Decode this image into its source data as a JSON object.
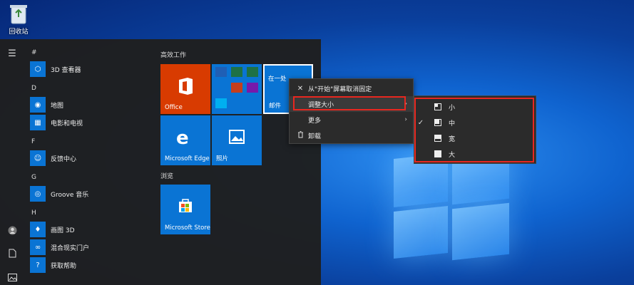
{
  "desktop": {
    "recycle_bin_label": "回收站"
  },
  "start_menu": {
    "letters": [
      "#",
      "D",
      "F",
      "G",
      "H"
    ],
    "apps": [
      {
        "name": "3D 查看器",
        "icon": "cube-icon"
      },
      {
        "name": "地图",
        "icon": "map-pin-icon"
      },
      {
        "name": "电影和电视",
        "icon": "film-icon"
      },
      {
        "name": "反馈中心",
        "icon": "feedback-icon"
      },
      {
        "name": "Groove 音乐",
        "icon": "music-disc-icon"
      },
      {
        "name": "画图 3D",
        "icon": "paint-drop-icon"
      },
      {
        "name": "混合现实门户",
        "icon": "mixed-reality-icon"
      },
      {
        "name": "获取帮助",
        "icon": "help-icon"
      }
    ],
    "groups": {
      "productivity": "高效工作",
      "browse": "浏览"
    },
    "tiles": {
      "office": "Office",
      "mail_text": "在一处查看所有邮件",
      "mail_short": "在一处",
      "mail_label": "邮件",
      "edge": "Microsoft Edge",
      "photos": "照片",
      "store": "Microsoft Store"
    }
  },
  "context_menu": {
    "items": [
      {
        "label": "从\"开始\"屏幕取消固定",
        "icon": "unpin-icon"
      },
      {
        "label": "调整大小",
        "icon": ""
      },
      {
        "label": "更多",
        "icon": ""
      },
      {
        "label": "卸载",
        "icon": "trash-icon"
      }
    ]
  },
  "resize_submenu": {
    "items": [
      {
        "label": "小",
        "checked": false
      },
      {
        "label": "中",
        "checked": true
      },
      {
        "label": "宽",
        "checked": false
      },
      {
        "label": "大",
        "checked": false
      }
    ],
    "check_glyph": "✓"
  },
  "colors": {
    "accent": "#0a74d4",
    "office": "#d83b01",
    "highlight": "#e8271f"
  }
}
